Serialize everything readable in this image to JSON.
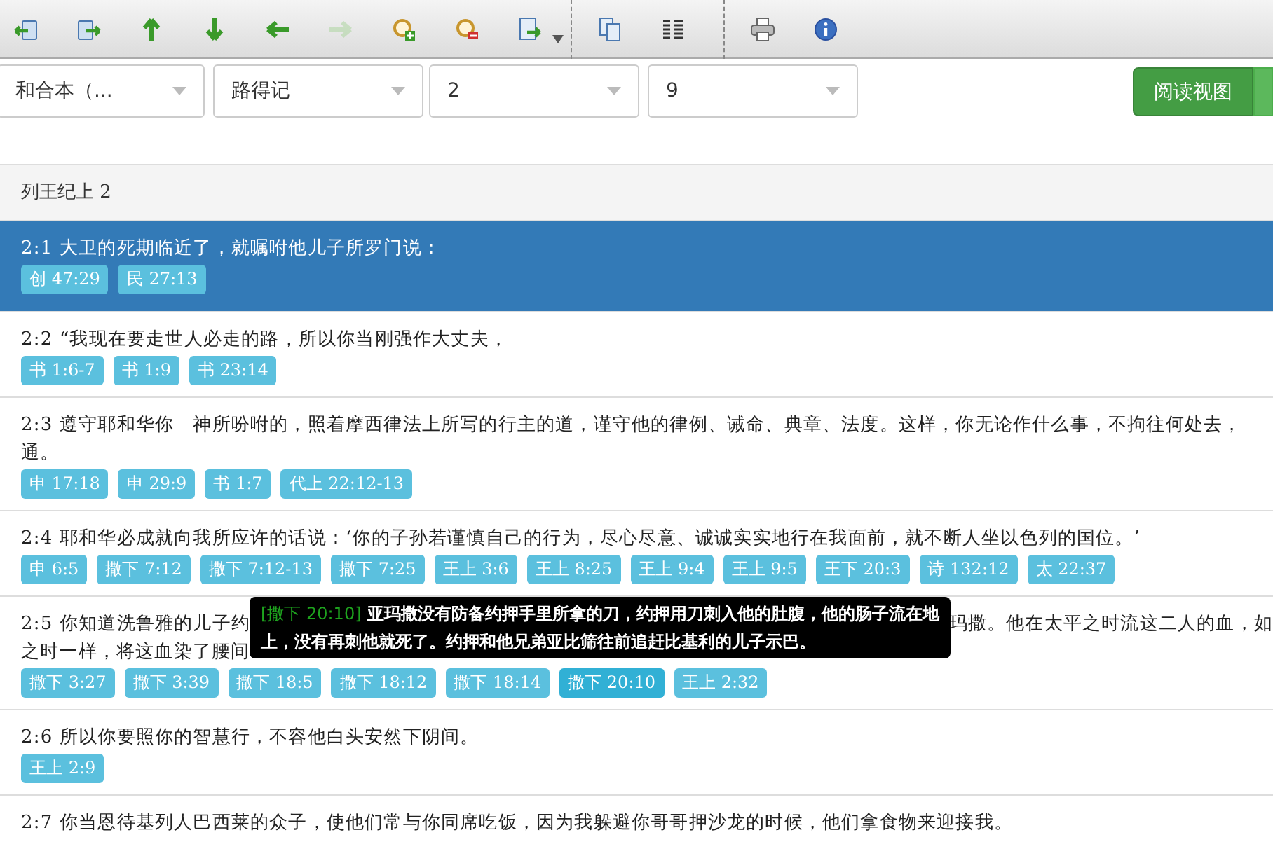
{
  "toolbar": [
    {
      "kind": "book-back",
      "disabled": false
    },
    {
      "kind": "book-forward",
      "disabled": false
    },
    {
      "kind": "up",
      "disabled": false
    },
    {
      "kind": "down",
      "disabled": false
    },
    {
      "kind": "left",
      "disabled": false
    },
    {
      "kind": "right",
      "disabled": true
    },
    {
      "kind": "zoom-in",
      "disabled": false
    },
    {
      "kind": "zoom-out",
      "disabled": false
    },
    {
      "kind": "export",
      "disabled": false
    },
    {
      "kind": "separator"
    },
    {
      "kind": "copy",
      "disabled": false
    },
    {
      "kind": "columns",
      "disabled": false
    },
    {
      "kind": "separator"
    },
    {
      "kind": "print",
      "disabled": false
    },
    {
      "kind": "info",
      "disabled": false
    }
  ],
  "selects": [
    {
      "value": "和合本（..."
    },
    {
      "value": "路得记"
    },
    {
      "value": "2"
    },
    {
      "value": "9"
    }
  ],
  "view_button": {
    "label": "阅读视图"
  },
  "chapter_title": "列王纪上 2",
  "verses": [
    {
      "selected": true,
      "lines": [
        [
          "2:1 大卫的死期临近了，就嘱咐他儿子所罗门说："
        ]
      ],
      "tags": [
        {
          "label": "创 47:29",
          "hovered": false
        },
        {
          "label": "民 27:13",
          "hovered": false
        }
      ]
    },
    {
      "selected": false,
      "lines": [
        [
          "2:2 “我现在要走世人必走的路，所以你当刚强作大丈夫，"
        ]
      ],
      "tags": [
        {
          "label": "书 1:6-7",
          "hovered": false
        },
        {
          "label": "书 1:9",
          "hovered": false
        },
        {
          "label": "书 23:14",
          "hovered": false
        }
      ]
    },
    {
      "selected": false,
      "lines": [
        [
          "2:3 遵守耶和华你　神所吩咐的，照着摩西律法上所写的行主的道，谨守他的律例、诫命、典章、法度。这样，你无论作什么事，不拘往何处去，"
        ],
        [
          "通。"
        ]
      ],
      "tags": [
        {
          "label": "申 17:18",
          "hovered": false
        },
        {
          "label": "申 29:9",
          "hovered": false
        },
        {
          "label": "书 1:7",
          "hovered": false
        },
        {
          "label": "代上 22:12-13",
          "hovered": false
        }
      ]
    },
    {
      "selected": false,
      "lines": [
        [
          "2:4 耶和华必成就向我所应许的话说：‘你的子孙若谨慎自己的行为，尽心尽意、诚诚实实地行在我面前，就不断人坐以色列的国位。’"
        ]
      ],
      "tags": [
        {
          "label": "申 6:5",
          "hovered": false
        },
        {
          "label": "撒下 7:12",
          "hovered": false
        },
        {
          "label": "撒下 7:12-13",
          "hovered": false
        },
        {
          "label": "撒下 7:25",
          "hovered": false
        },
        {
          "label": "王上 3:6",
          "hovered": false
        },
        {
          "label": "王上 8:25",
          "hovered": false
        },
        {
          "label": "王上 9:4",
          "hovered": false
        },
        {
          "label": "王上 9:5",
          "hovered": false
        },
        {
          "label": "王下 20:3",
          "hovered": false
        },
        {
          "label": "诗 132:12",
          "hovered": false
        },
        {
          "label": "太 22:37",
          "hovered": false
        }
      ]
    },
    {
      "selected": false,
      "lines": [
        [
          "2:5 你知道洗鲁雅的儿子约",
          "玛撒。他在太平之时流这二人的血，如"
        ],
        [
          "之时一样，将这血染了腰间"
        ]
      ],
      "tags": [
        {
          "label": "撒下 3:27",
          "hovered": false
        },
        {
          "label": "撒下 3:39",
          "hovered": false
        },
        {
          "label": "撒下 18:5",
          "hovered": false
        },
        {
          "label": "撒下 18:12",
          "hovered": false
        },
        {
          "label": "撒下 18:14",
          "hovered": false
        },
        {
          "label": "撒下 20:10",
          "hovered": true
        },
        {
          "label": "王上 2:32",
          "hovered": false
        }
      ],
      "tooltip": {
        "reference": "[撒下 20:10]",
        "text": "亚玛撒没有防备约押手里所拿的刀，约押用刀刺入他的肚腹，他的肠子流在地上，没有再刺他就死了。约押和他兄弟亚比筛往前追赶比基利的儿子示巴。"
      }
    },
    {
      "selected": false,
      "lines": [
        [
          "2:6 所以你要照你的智慧行，不容他白头安然下阴间。"
        ]
      ],
      "tags": [
        {
          "label": "王上 2:9",
          "hovered": false
        }
      ]
    },
    {
      "selected": false,
      "lines": [
        [
          "2:7 你当恩待基列人巴西莱的众子，使他们常与你同席吃饭，因为我躲避你哥哥押沙龙的时候，他们拿食物来迎接我。"
        ]
      ]
    }
  ]
}
